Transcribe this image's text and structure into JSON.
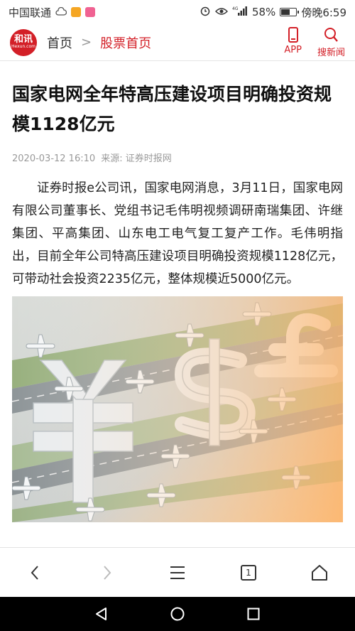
{
  "status_bar": {
    "carrier": "中国联通",
    "signal_label": "4G",
    "battery": "58%",
    "battery_level": 0.58,
    "time": "傍晚6:59",
    "icons": [
      "cloud-icon",
      "app-badge-icon",
      "app-badge-icon",
      "alarm-icon",
      "eye-icon",
      "signal-icon",
      "battery-icon"
    ]
  },
  "header": {
    "logo_text": "和讯",
    "logo_subtext": "Hexun.com",
    "breadcrumb_home": "首页",
    "breadcrumb_sep": ">",
    "breadcrumb_current": "股票首页",
    "app_label": "APP",
    "search_label": "搜新闻"
  },
  "article": {
    "title": "国家电网全年特高压建设项目明确投资规模1128亿元",
    "date": "2020-03-12 16:10",
    "source": "来源: 证券时报网",
    "paragraph": "证券时报e公司讯，国家电网消息，3月11日，国家电网有限公司董事长、党组书记毛伟明视频调研南瑞集团、许继集团、平高集团、山东电工电气复工复产工作。毛伟明指出，目前全年公司特高压建设项目明确投资规模1128亿元，可带动社会投资2235亿元，整体规模近5000亿元。"
  },
  "browser_bar": {
    "tabs_count": "1"
  },
  "colors": {
    "brand_red": "#d31f27",
    "text": "#222222",
    "meta": "#999999"
  }
}
